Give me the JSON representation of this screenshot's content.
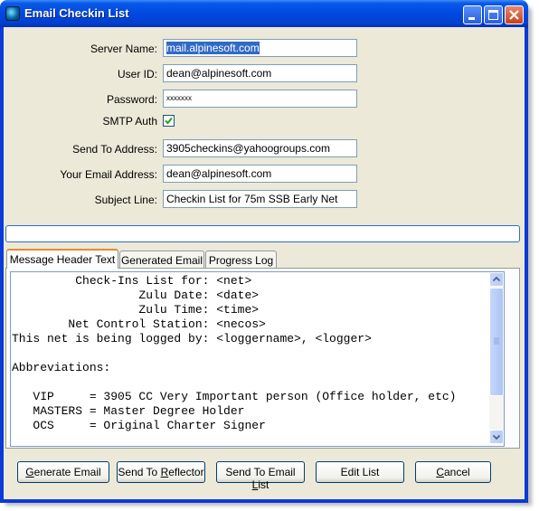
{
  "window": {
    "title": "Email Checkin List"
  },
  "form": {
    "server_name": {
      "label": "Server Name:",
      "value": "mail.alpinesoft.com"
    },
    "user_id": {
      "label": "User ID:",
      "value": "dean@alpinesoft.com"
    },
    "password": {
      "label": "Password:",
      "value": "xxxxxxx"
    },
    "smtp_auth": {
      "label": "SMTP Auth",
      "checked": true
    },
    "send_to": {
      "label": "Send To Address:",
      "value": "3905checkins@yahoogroups.com"
    },
    "your_email": {
      "label": "Your Email Address:",
      "value": "dean@alpinesoft.com"
    },
    "subject": {
      "label": "Subject Line:",
      "value": "Checkin List for 75m SSB Early Net"
    }
  },
  "tabs": [
    {
      "label": "Message Header Text",
      "active": true
    },
    {
      "label": "Generated Email",
      "active": false
    },
    {
      "label": "Progress Log",
      "active": false
    }
  ],
  "message_text": "         Check-Ins List for: <net>\n                  Zulu Date: <date>\n                  Zulu Time: <time>\n        Net Control Station: <necos>\nThis net is being logged by: <loggername>, <logger>\n\nAbbreviations:\n\n   VIP     = 3905 CC Very Important person (Office holder, etc)\n   MASTERS = Master Degree Holder\n   OCS     = Original Charter Signer",
  "buttons": {
    "generate": {
      "pre": "",
      "u": "G",
      "post": "enerate Email"
    },
    "reflector": {
      "pre": "Send To ",
      "u": "R",
      "post": "eflector"
    },
    "email_list": {
      "pre": "Send To Email ",
      "u": "L",
      "post": "ist"
    },
    "edit_list": {
      "pre": "Edit List",
      "u": "",
      "post": ""
    },
    "cancel": {
      "pre": "",
      "u": "C",
      "post": "ancel"
    }
  }
}
